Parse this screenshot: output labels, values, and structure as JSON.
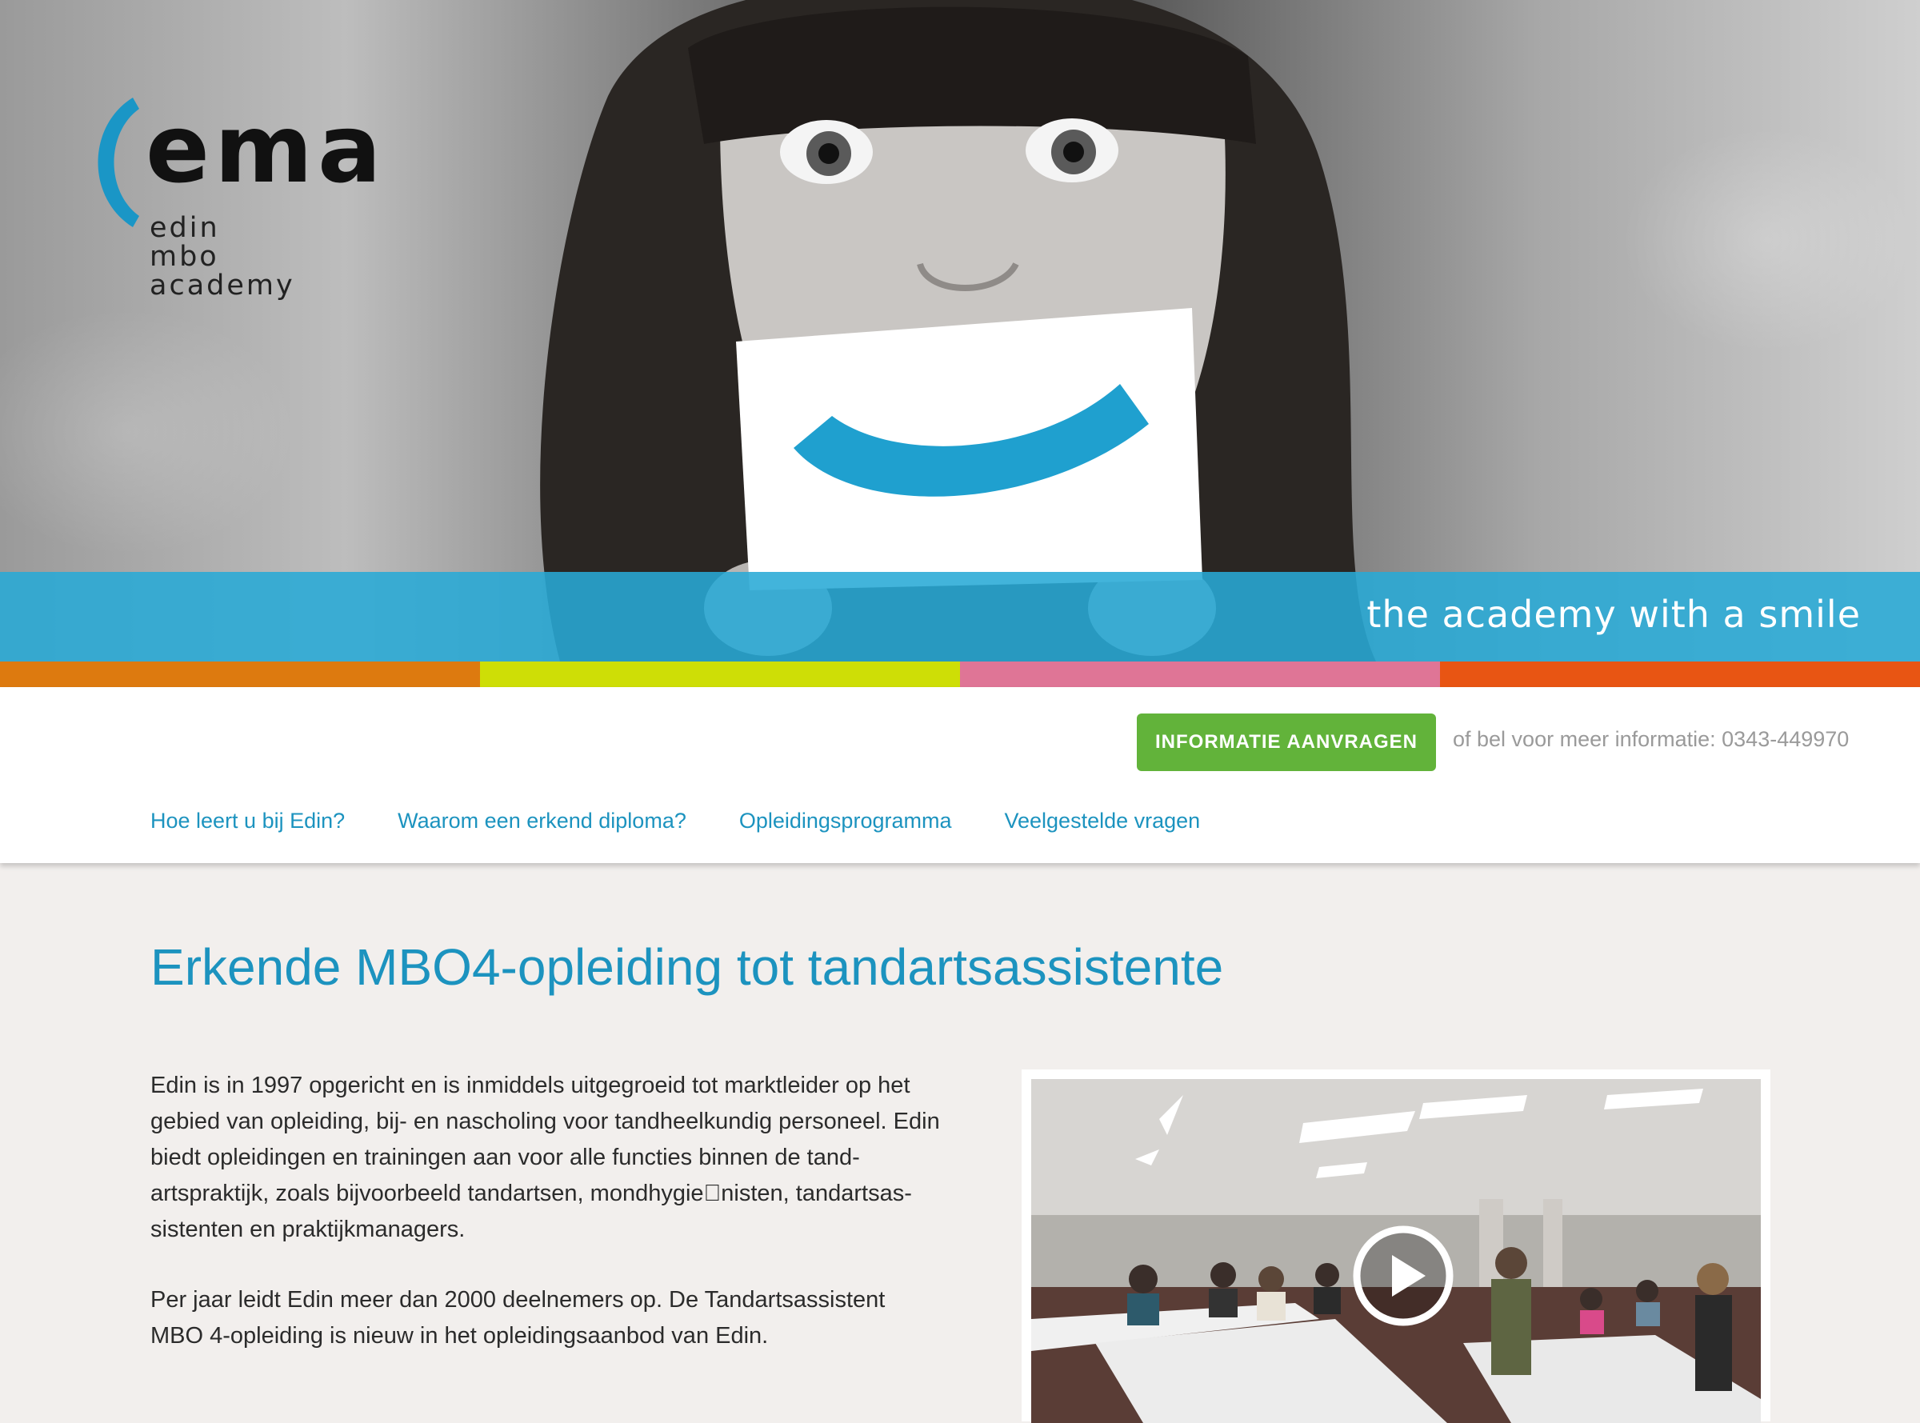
{
  "brand": {
    "logo_wordmark": "ema",
    "logo_lines": [
      "edin",
      "mbo",
      "academy"
    ],
    "tagline": "the academy with a smile",
    "accent_color": "#1c93bf"
  },
  "stripe_colors": [
    "#dd7a0f",
    "#cede06",
    "#df7596",
    "#e85513"
  ],
  "header": {
    "cta_label": "INFORMATIE AANVRAGEN",
    "phone_text": "of bel voor meer informatie: 0343-449970"
  },
  "nav": {
    "items": [
      {
        "label": "Hoe leert u bij Edin?"
      },
      {
        "label": "Waarom een erkend diploma?"
      },
      {
        "label": "Opleidingsprogramma"
      },
      {
        "label": "Veelgestelde vragen"
      }
    ]
  },
  "main": {
    "title": "Erkende MBO4-opleiding tot tandartsassistente",
    "paragraphs": [
      "Edin is in 1997 opgericht en is inmiddels uitgegroeid tot marktleider op het gebied van opleiding, bij- en nascholing voor tandheelkundig personeel. Edin biedt opleidingen en trainingen aan voor alle functies binnen de tand-artspraktijk, zoals bijvoorbeeld tandartsen, mondhygie\u0000nisten, tandartsas-sistenten en praktijkmanagers.",
      "Per jaar leidt Edin meer dan 2000 deelnemers op. De Tandartsassistent MBO 4-opleiding is nieuw in het opleidingsaanbod van Edin."
    ]
  },
  "video": {
    "play_icon": "play-icon"
  }
}
